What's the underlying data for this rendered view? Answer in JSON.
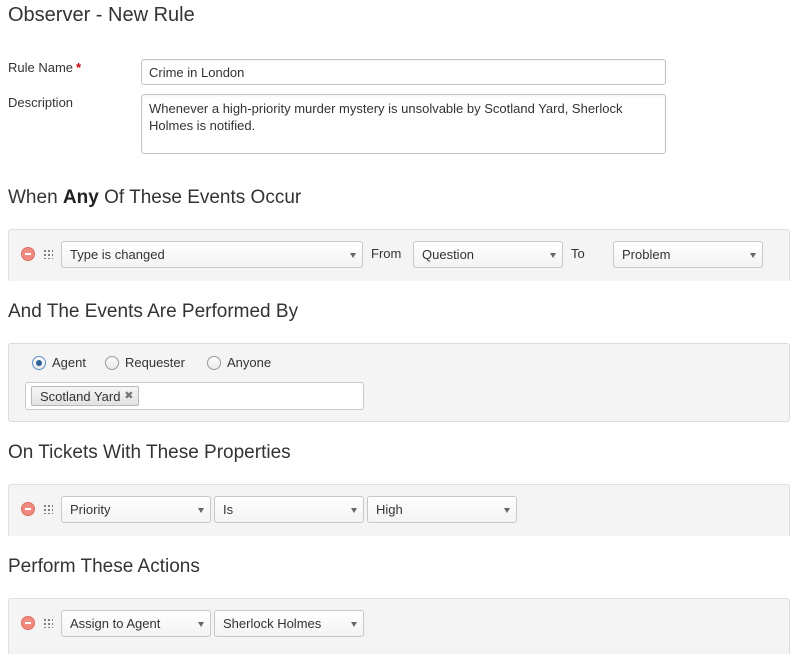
{
  "page": {
    "title": "Observer - New Rule"
  },
  "form": {
    "rule_name_label": "Rule Name",
    "rule_name_required": "*",
    "rule_name_value": "Crime in London",
    "description_label": "Description",
    "description_value": "Whenever a high-priority murder mystery is unsolvable by Scotland Yard, Sherlock Holmes is notified."
  },
  "events": {
    "heading_prefix": "When",
    "heading_bold": "Any",
    "heading_suffix": "Of These Events Occur",
    "condition": {
      "event": "Type is changed",
      "from_label": "From",
      "from_value": "Question",
      "to_label": "To",
      "to_value": "Problem"
    }
  },
  "performed_by": {
    "heading": "And The Events Are Performed By",
    "options": [
      "Agent",
      "Requester",
      "Anyone"
    ],
    "selected": "Agent",
    "tokens": [
      "Scotland Yard"
    ],
    "token_remove_glyph": "✖"
  },
  "properties": {
    "heading": "On Tickets With These Properties",
    "condition": {
      "field": "Priority",
      "operator": "Is",
      "value": "High"
    }
  },
  "actions": {
    "heading": "Perform These Actions",
    "action": {
      "type": "Assign to Agent",
      "value": "Sherlock Holmes"
    }
  },
  "icons": {
    "remove": "remove-circle-icon",
    "drag": "drag-handle-icon",
    "dropdown": "chevron-down-icon"
  },
  "colors": {
    "remove_icon": "#f08a80",
    "required": "#cc0000",
    "radio_selected": "#2e5e96"
  }
}
